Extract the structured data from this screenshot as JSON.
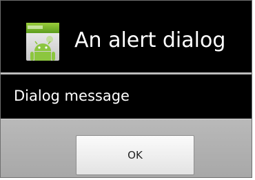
{
  "dialog": {
    "title": "An alert dialog",
    "app_icon": "android-app-icon",
    "message": "Dialog message"
  },
  "buttons": {
    "ok_label": "OK"
  },
  "colors": {
    "title_background": "#000000",
    "divider": "#bcbcbc",
    "button_bar": "#b0b0b0"
  }
}
